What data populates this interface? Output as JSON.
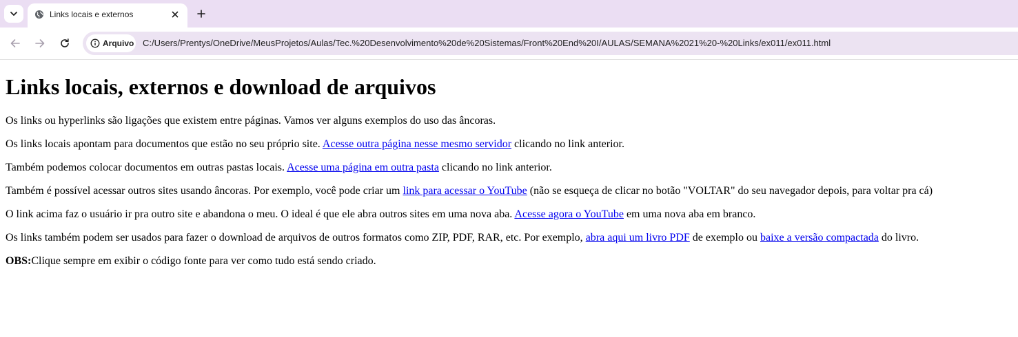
{
  "browser": {
    "tab": {
      "title": "Links locais e externos",
      "favicon": "globe-icon"
    },
    "toolbar": {
      "security_label": "Arquivo",
      "security_icon": "info-icon",
      "url": "C:/Users/Prentys/OneDrive/MeusProjetos/Aulas/Tec.%20Desenvolvimento%20de%20Sistemas/Front%20End%20I/AULAS/SEMANA%2021%20-%20Links/ex011/ex011.html"
    },
    "colors": {
      "tabstrip_bg": "#ebdef3",
      "omnibox_bg": "#ece3f2",
      "link": "#0000ee"
    }
  },
  "page": {
    "heading": "Links locais, externos e download de arquivos",
    "p1": "Os links ou hyperlinks são ligações que existem entre páginas. Vamos ver alguns exemplos do uso das âncoras.",
    "p2": {
      "before": "Os links locais apontam para documentos que estão no seu próprio site. ",
      "link": "Acesse outra página nesse mesmo servidor",
      "after": " clicando no link anterior."
    },
    "p3": {
      "before": "Também podemos colocar documentos em outras pastas locais. ",
      "link": "Acesse uma página em outra pasta",
      "after": " clicando no link anterior."
    },
    "p4": {
      "before": "Também é possível acessar outros sites usando âncoras. Por exemplo, você pode criar um ",
      "link": "link para acessar o YouTube",
      "after": " (não se esqueça de clicar no botão \"VOLTAR\" do seu navegador depois, para voltar pra cá)"
    },
    "p5": {
      "before": "O link acima faz o usuário ir pra outro site e abandona o meu. O ideal é que ele abra outros sites em uma nova aba. ",
      "link": "Acesse agora o YouTube",
      "after": " em uma nova aba em branco."
    },
    "p6": {
      "before": "Os links também podem ser usados para fazer o download de arquivos de outros formatos como ZIP, PDF, RAR, etc. Por exemplo, ",
      "link1": "abra aqui um livro PDF",
      "middle": " de exemplo ou ",
      "link2": "baixe a versão compactada",
      "after": " do livro."
    },
    "p7": {
      "strong": "OBS:",
      "text": "Clique sempre em exibir o código fonte para ver como tudo está sendo criado."
    }
  }
}
